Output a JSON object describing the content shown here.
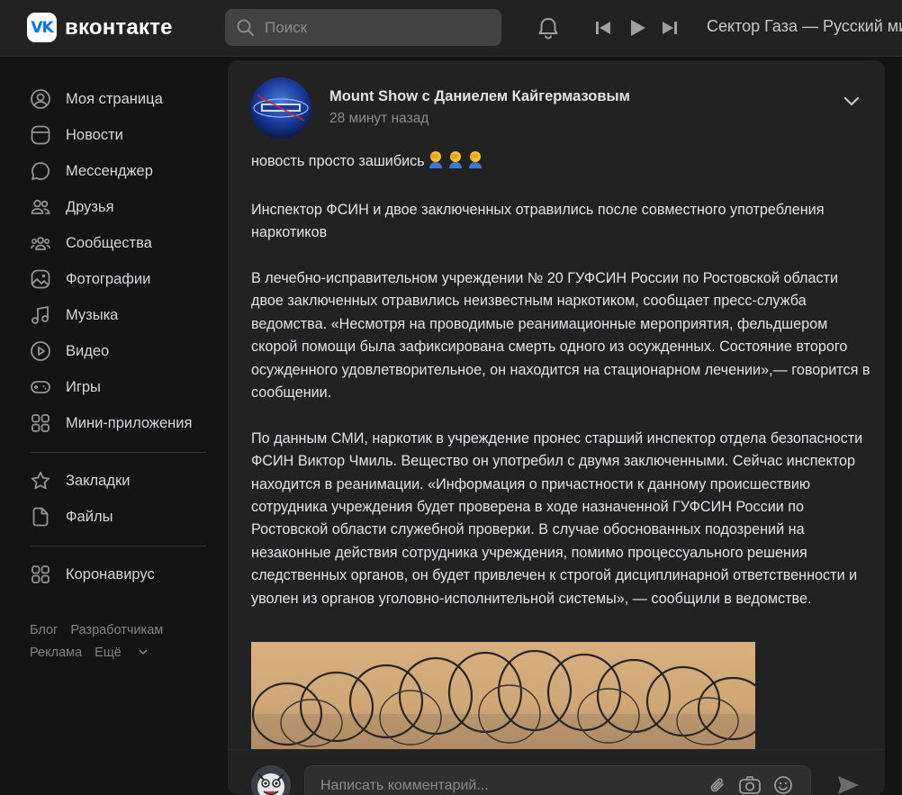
{
  "header": {
    "logo_badge": "VK",
    "logo_text": "вконтакте",
    "search_placeholder": "Поиск",
    "now_playing": "Сектор Газа — Русский мир"
  },
  "sidebar": {
    "items": [
      {
        "label": "Моя страница",
        "icon": "user-circle-icon"
      },
      {
        "label": "Новости",
        "icon": "news-icon"
      },
      {
        "label": "Мессенджер",
        "icon": "message-icon"
      },
      {
        "label": "Друзья",
        "icon": "friends-icon"
      },
      {
        "label": "Сообщества",
        "icon": "communities-icon"
      },
      {
        "label": "Фотографии",
        "icon": "photo-icon"
      },
      {
        "label": "Музыка",
        "icon": "music-icon"
      },
      {
        "label": "Видео",
        "icon": "video-icon"
      },
      {
        "label": "Игры",
        "icon": "gamepad-icon"
      },
      {
        "label": "Мини-приложения",
        "icon": "apps-icon"
      }
    ],
    "items2": [
      {
        "label": "Закладки",
        "icon": "star-icon"
      },
      {
        "label": "Файлы",
        "icon": "file-icon"
      }
    ],
    "items3": [
      {
        "label": "Коронавирус",
        "icon": "apps-icon"
      }
    ],
    "footer": {
      "blog": "Блог",
      "developers": "Разработчикам",
      "ads": "Реклама",
      "more": "Ещё"
    }
  },
  "post": {
    "author": "Mount Show с Даниелем Кайгермазовым",
    "time": "28 минут назад",
    "intro": "новость просто зашибись",
    "title": "Инспектор ФСИН и двое заключенных отравились после совместного употребления наркотиков",
    "para1": "В лечебно-исправительном учреждении № 20 ГУФСИН России по Ростовской области двое заключенных отравились неизвестным наркотиком, сообщает пресс-служба ведомства. «Несмотря на проводимые реанимационные мероприятия, фельдшером скорой помощи была зафиксирована смерть одного из осужденных. Состояние второго осужденного удовлетворительное, он находится на стационарном лечении»,— говорится в сообщении.",
    "para2": "По данным СМИ, наркотик в учреждение пронес старший инспектор отдела безопасности ФСИН Виктор Чмиль. Вещество он употребил с двумя заключенными. Сейчас инспектор находится в реанимации. «Информация о причастности к данному происшествию сотрудника учреждения будет проверена в ходе назначенной ГУФСИН России по Ростовской области служебной проверки. В случае обоснованных подозрений на незаконные действия сотрудника учреждения, помимо процессуального решения следственных органов, он будет привлечен к строгой дисциплинарной ответственности и уволен из органов уголовно-исполнительной системы», — сообщили в ведомстве."
  },
  "comment": {
    "placeholder": "Написать комментарий..."
  },
  "colors": {
    "background": "#141414",
    "panel": "#222222",
    "accent": "#0077ff"
  }
}
